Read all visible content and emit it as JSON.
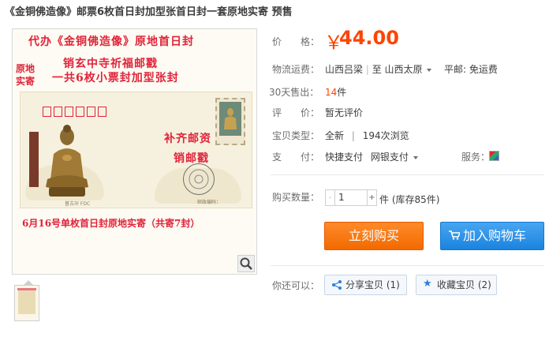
{
  "title": "《金铜佛造像》邮票6枚首日封加型张首日封一套原地实寄 预售",
  "image": {
    "handwriting": {
      "line1": "代办《金铜佛造像》原地首日封",
      "line2": "原地实寄",
      "line3": "销玄中寺祈福邮戳",
      "line4": "一共6枚小票封加型张封",
      "line5": "补齐邮资",
      "line6": "销邮戳",
      "line7": "6月16号单枚首日封原地实寄（共寄7封）"
    },
    "envelope_text_left": "普古卍 FDC",
    "envelope_text_right": "邮政编码："
  },
  "zoom_icon": "search-icon",
  "price": {
    "label": "价　　格：",
    "currency": "￥",
    "value": "44.00",
    "color": "#ff4400"
  },
  "shipping": {
    "label": "物流运费：",
    "from": "山西吕梁",
    "separator": "至",
    "to": "山西太原",
    "fee": "平邮: 免运费"
  },
  "sales": {
    "label": "30天售出：",
    "count": "14",
    "unit": "件"
  },
  "review": {
    "label": "评　　价：",
    "value": "暂无评价"
  },
  "item_type": {
    "label": "宝贝类型：",
    "condition": "全新",
    "divider": "|",
    "views": "194次浏览"
  },
  "payment": {
    "label": "支　　付：",
    "methods": [
      "快捷支付",
      "网银支付"
    ],
    "service_label": "服务："
  },
  "quantity": {
    "label": "购买数量：",
    "minus": "-",
    "value": "1",
    "plus": "+",
    "stock_text": "件 (库存85件)"
  },
  "buttons": {
    "buy_now": "立刻购买",
    "add_cart": "加入购物车",
    "buy_color": "#f26a00",
    "cart_color": "#1a84e0"
  },
  "social": {
    "label": "你还可以：",
    "share": "分享宝贝 (1)",
    "favorite": "收藏宝贝 (2)"
  }
}
